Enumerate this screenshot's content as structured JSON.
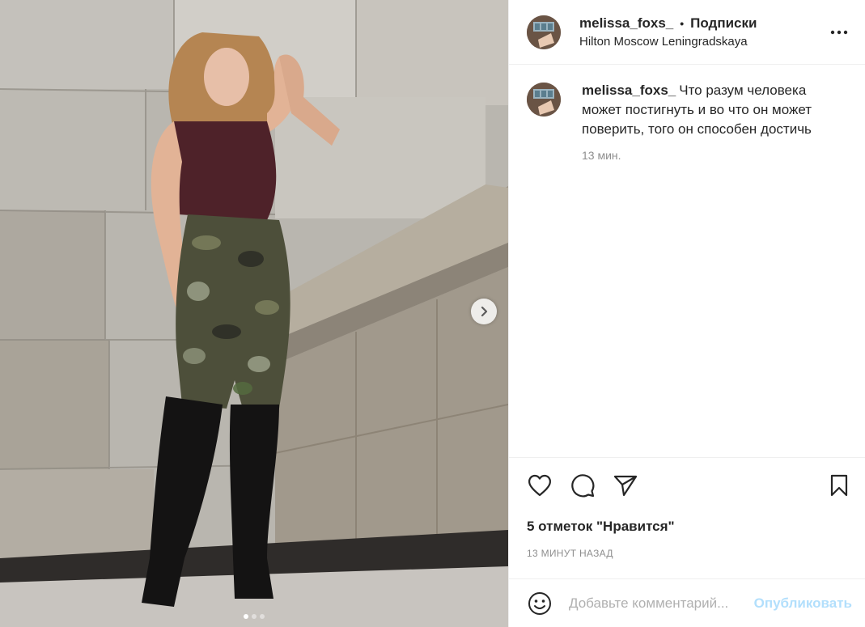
{
  "post": {
    "username": "melissa_foxs_",
    "separator": "•",
    "follow_label": "Подписки",
    "location": "Hilton Moscow Leningradskaya"
  },
  "caption": {
    "username": "melissa_foxs_",
    "text": "Что разум человека может постигнуть и во что он может поверить, того он способен достичь",
    "time": "13 мин."
  },
  "actions": {
    "like_icon": "heart-icon",
    "comment_icon": "comment-icon",
    "share_icon": "paper-plane-icon",
    "save_icon": "bookmark-icon"
  },
  "likes_text": "5 отметок \"Нравится\"",
  "time_ago": "13 МИНУТ НАЗАД",
  "comment_box": {
    "placeholder": "Добавьте комментарий...",
    "post_label": "Опубликовать"
  },
  "carousel": {
    "slides": 3,
    "active_slide": 1
  },
  "colors": {
    "accent_disabled": "#b2dffc",
    "secondary_text": "#8e8e8e",
    "divider": "#efefef"
  }
}
